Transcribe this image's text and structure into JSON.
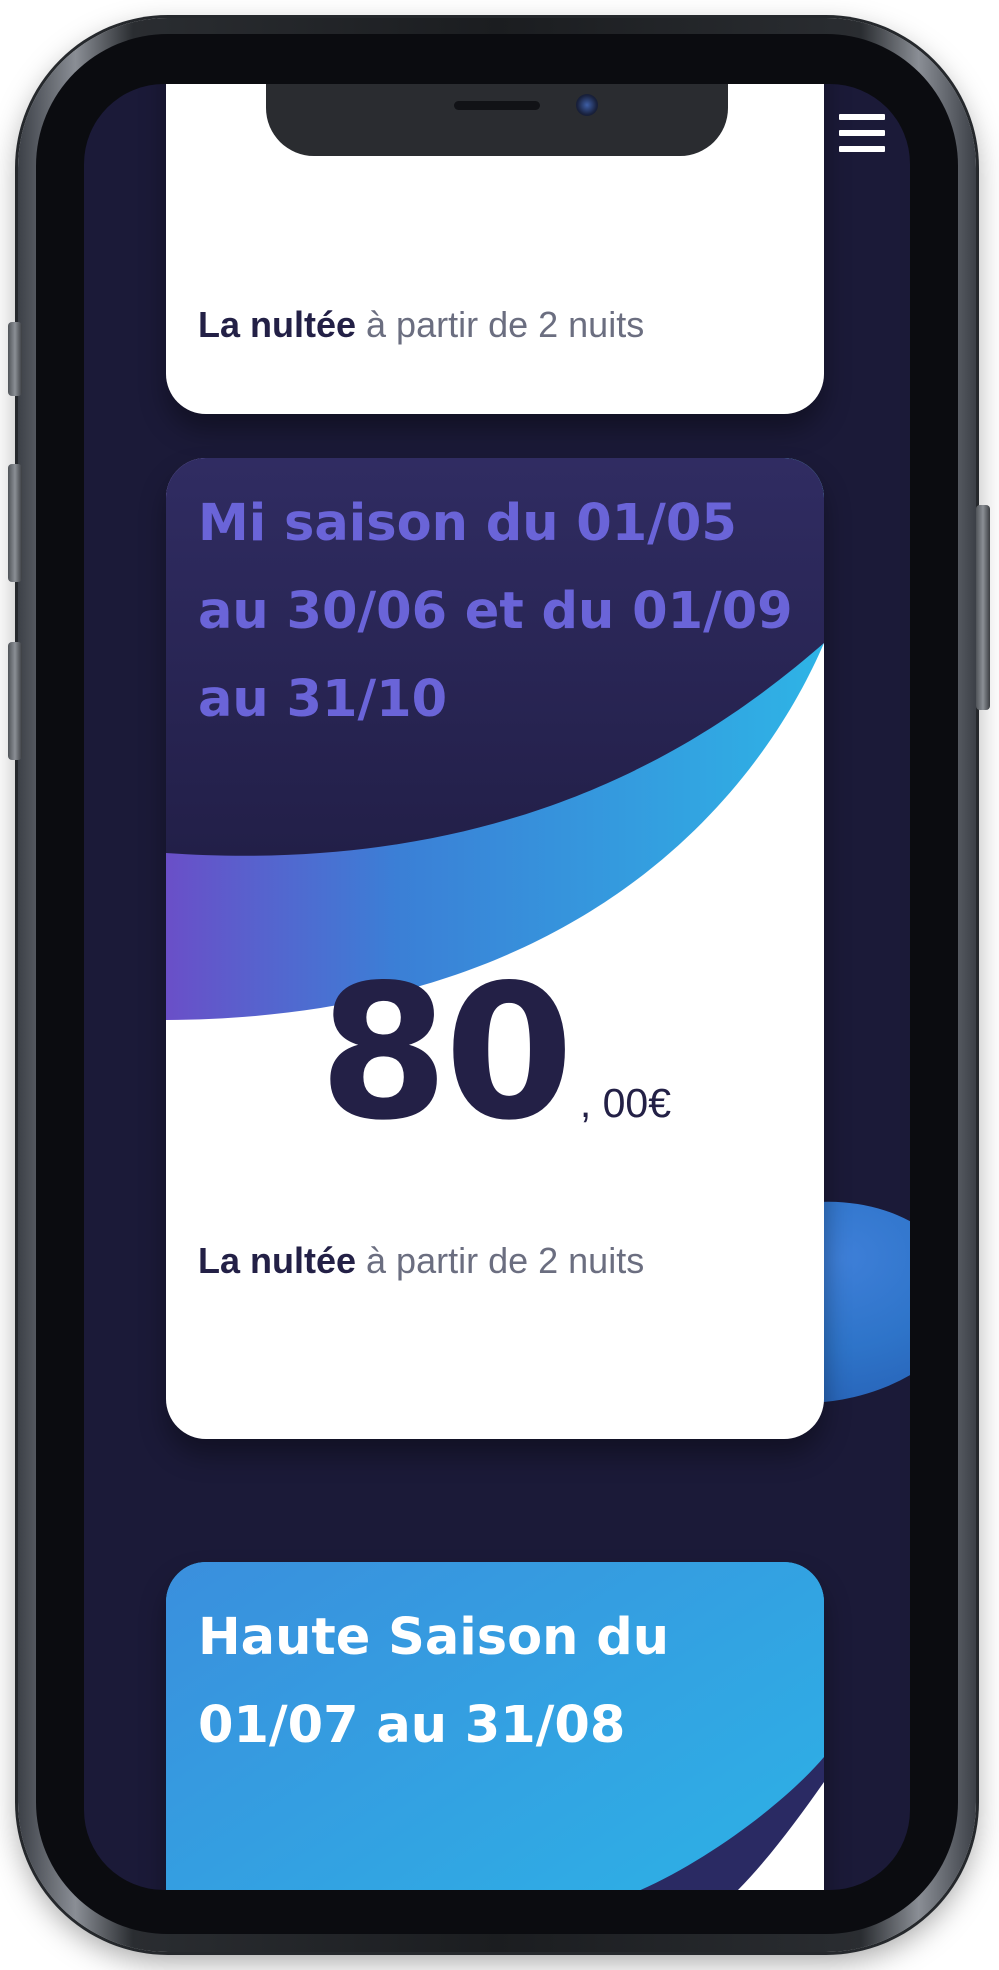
{
  "colors": {
    "screen_background": "#1b1a38",
    "card_background": "#ffffff",
    "mid_season_title": "#6a64d8",
    "price_text": "#232046",
    "accent_blue": "#2eb1e4",
    "dark_wave": "#28254d"
  },
  "header": {
    "menu_icon": "hamburger-menu-icon"
  },
  "cards": [
    {
      "title": "",
      "note_bold": "La nultée",
      "note_rest": " à partir de 2 nuits"
    },
    {
      "title": "Mi saison du 01/05 au 30/06 et du 01/09 au 31/10",
      "price_integer": "80",
      "price_decimal": ", 00€",
      "note_bold": "La nultée",
      "note_rest": " à partir de 2 nuits"
    },
    {
      "title": "Haute Saison du 01/07 au 31/08"
    }
  ]
}
